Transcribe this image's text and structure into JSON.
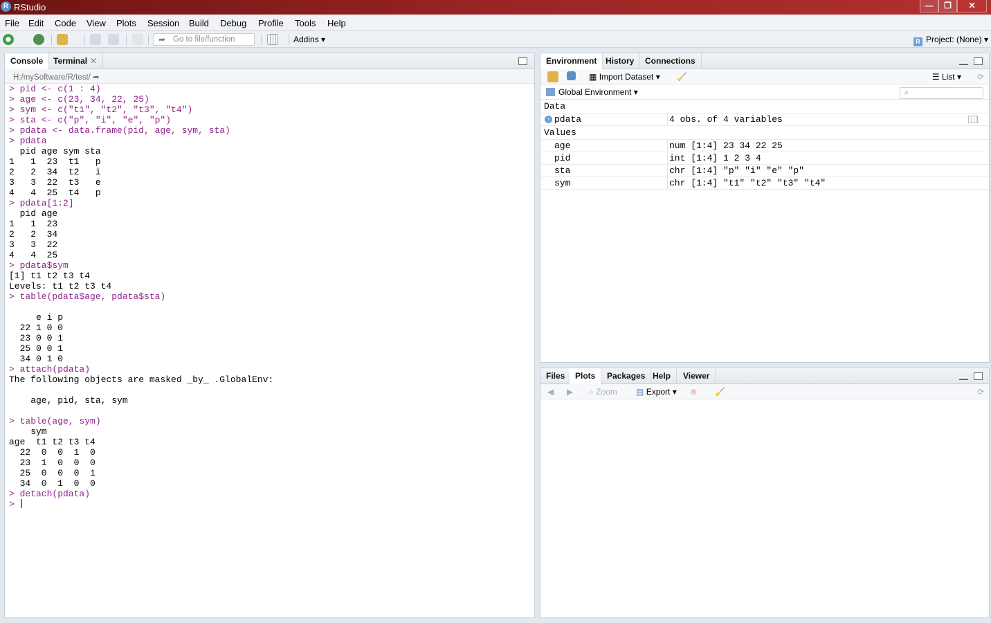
{
  "window": {
    "title": "RStudio",
    "controls": {
      "minimize": "—",
      "restore": "❐",
      "close": "✕"
    }
  },
  "menu": [
    "File",
    "Edit",
    "Code",
    "View",
    "Plots",
    "Session",
    "Build",
    "Debug",
    "Profile",
    "Tools",
    "Help"
  ],
  "toolbar": {
    "goto_placeholder": "Go to file/function",
    "addins": "Addins",
    "project": "Project: (None)",
    "project_badge": "R"
  },
  "left_pane": {
    "tabs": [
      {
        "label": "Console",
        "active": true
      },
      {
        "label": "Terminal",
        "active": false,
        "closable": true
      }
    ],
    "path": "H:/mySoftware/R/test/",
    "lines": [
      {
        "type": "in",
        "text": "> pid <- c(1 : 4)"
      },
      {
        "type": "in",
        "text": "> age <- c(23, 34, 22, 25)"
      },
      {
        "type": "in",
        "text": "> sym <- c(\"t1\", \"t2\", \"t3\", \"t4\")"
      },
      {
        "type": "in",
        "text": "> sta <- c(\"p\", \"i\", \"e\", \"p\")"
      },
      {
        "type": "in",
        "text": "> pdata <- data.frame(pid, age, sym, sta)"
      },
      {
        "type": "in",
        "text": "> pdata"
      },
      {
        "type": "out",
        "text": "  pid age sym sta"
      },
      {
        "type": "out",
        "text": "1   1  23  t1   p"
      },
      {
        "type": "out",
        "text": "2   2  34  t2   i"
      },
      {
        "type": "out",
        "text": "3   3  22  t3   e"
      },
      {
        "type": "out",
        "text": "4   4  25  t4   p"
      },
      {
        "type": "in",
        "text": "> pdata[1:2]"
      },
      {
        "type": "out",
        "text": "  pid age"
      },
      {
        "type": "out",
        "text": "1   1  23"
      },
      {
        "type": "out",
        "text": "2   2  34"
      },
      {
        "type": "out",
        "text": "3   3  22"
      },
      {
        "type": "out",
        "text": "4   4  25"
      },
      {
        "type": "in",
        "text": "> pdata$sym"
      },
      {
        "type": "out",
        "text": "[1] t1 t2 t3 t4"
      },
      {
        "type": "out",
        "text": "Levels: t1 t2 t3 t4"
      },
      {
        "type": "in",
        "text": "> table(pdata$age, pdata$sta)"
      },
      {
        "type": "out",
        "text": ""
      },
      {
        "type": "out",
        "text": "     e i p"
      },
      {
        "type": "out",
        "text": "  22 1 0 0"
      },
      {
        "type": "out",
        "text": "  23 0 0 1"
      },
      {
        "type": "out",
        "text": "  25 0 0 1"
      },
      {
        "type": "out",
        "text": "  34 0 1 0"
      },
      {
        "type": "in",
        "text": "> attach(pdata)"
      },
      {
        "type": "out",
        "text": "The following objects are masked _by_ .GlobalEnv:"
      },
      {
        "type": "out",
        "text": ""
      },
      {
        "type": "out",
        "text": "    age, pid, sta, sym"
      },
      {
        "type": "out",
        "text": ""
      },
      {
        "type": "in",
        "text": "> table(age, sym)"
      },
      {
        "type": "out",
        "text": "    sym"
      },
      {
        "type": "out",
        "text": "age  t1 t2 t3 t4"
      },
      {
        "type": "out",
        "text": "  22  0  0  1  0"
      },
      {
        "type": "out",
        "text": "  23  1  0  0  0"
      },
      {
        "type": "out",
        "text": "  25  0  0  0  1"
      },
      {
        "type": "out",
        "text": "  34  0  1  0  0"
      },
      {
        "type": "in",
        "text": "> detach(pdata)"
      },
      {
        "type": "in",
        "text": "> "
      }
    ]
  },
  "env_pane": {
    "tabs": [
      {
        "label": "Environment",
        "active": true
      },
      {
        "label": "History",
        "active": false
      },
      {
        "label": "Connections",
        "active": false
      }
    ],
    "import_dataset": "Import Dataset",
    "view_mode": "List",
    "scope": "Global Environment",
    "sections": {
      "data": "Data",
      "values": "Values"
    },
    "data_rows": [
      {
        "name": "pdata",
        "value": "4 obs. of 4 variables"
      }
    ],
    "value_rows": [
      {
        "name": "age",
        "value": "num [1:4] 23 34 22 25"
      },
      {
        "name": "pid",
        "value": "int [1:4] 1 2 3 4"
      },
      {
        "name": "sta",
        "value": "chr [1:4] \"p\" \"i\" \"e\" \"p\""
      },
      {
        "name": "sym",
        "value": "chr [1:4] \"t1\" \"t2\" \"t3\" \"t4\""
      }
    ]
  },
  "files_pane": {
    "tabs": [
      {
        "label": "Files",
        "active": false
      },
      {
        "label": "Plots",
        "active": true
      },
      {
        "label": "Packages",
        "active": false
      },
      {
        "label": "Help",
        "active": false
      },
      {
        "label": "Viewer",
        "active": false
      }
    ],
    "zoom": "Zoom",
    "export": "Export"
  },
  "colors": {
    "title_bar": "#9a2424",
    "console_input": "#8e2389",
    "console_output": "#000000",
    "accent_blue": "#6a9fd6"
  }
}
